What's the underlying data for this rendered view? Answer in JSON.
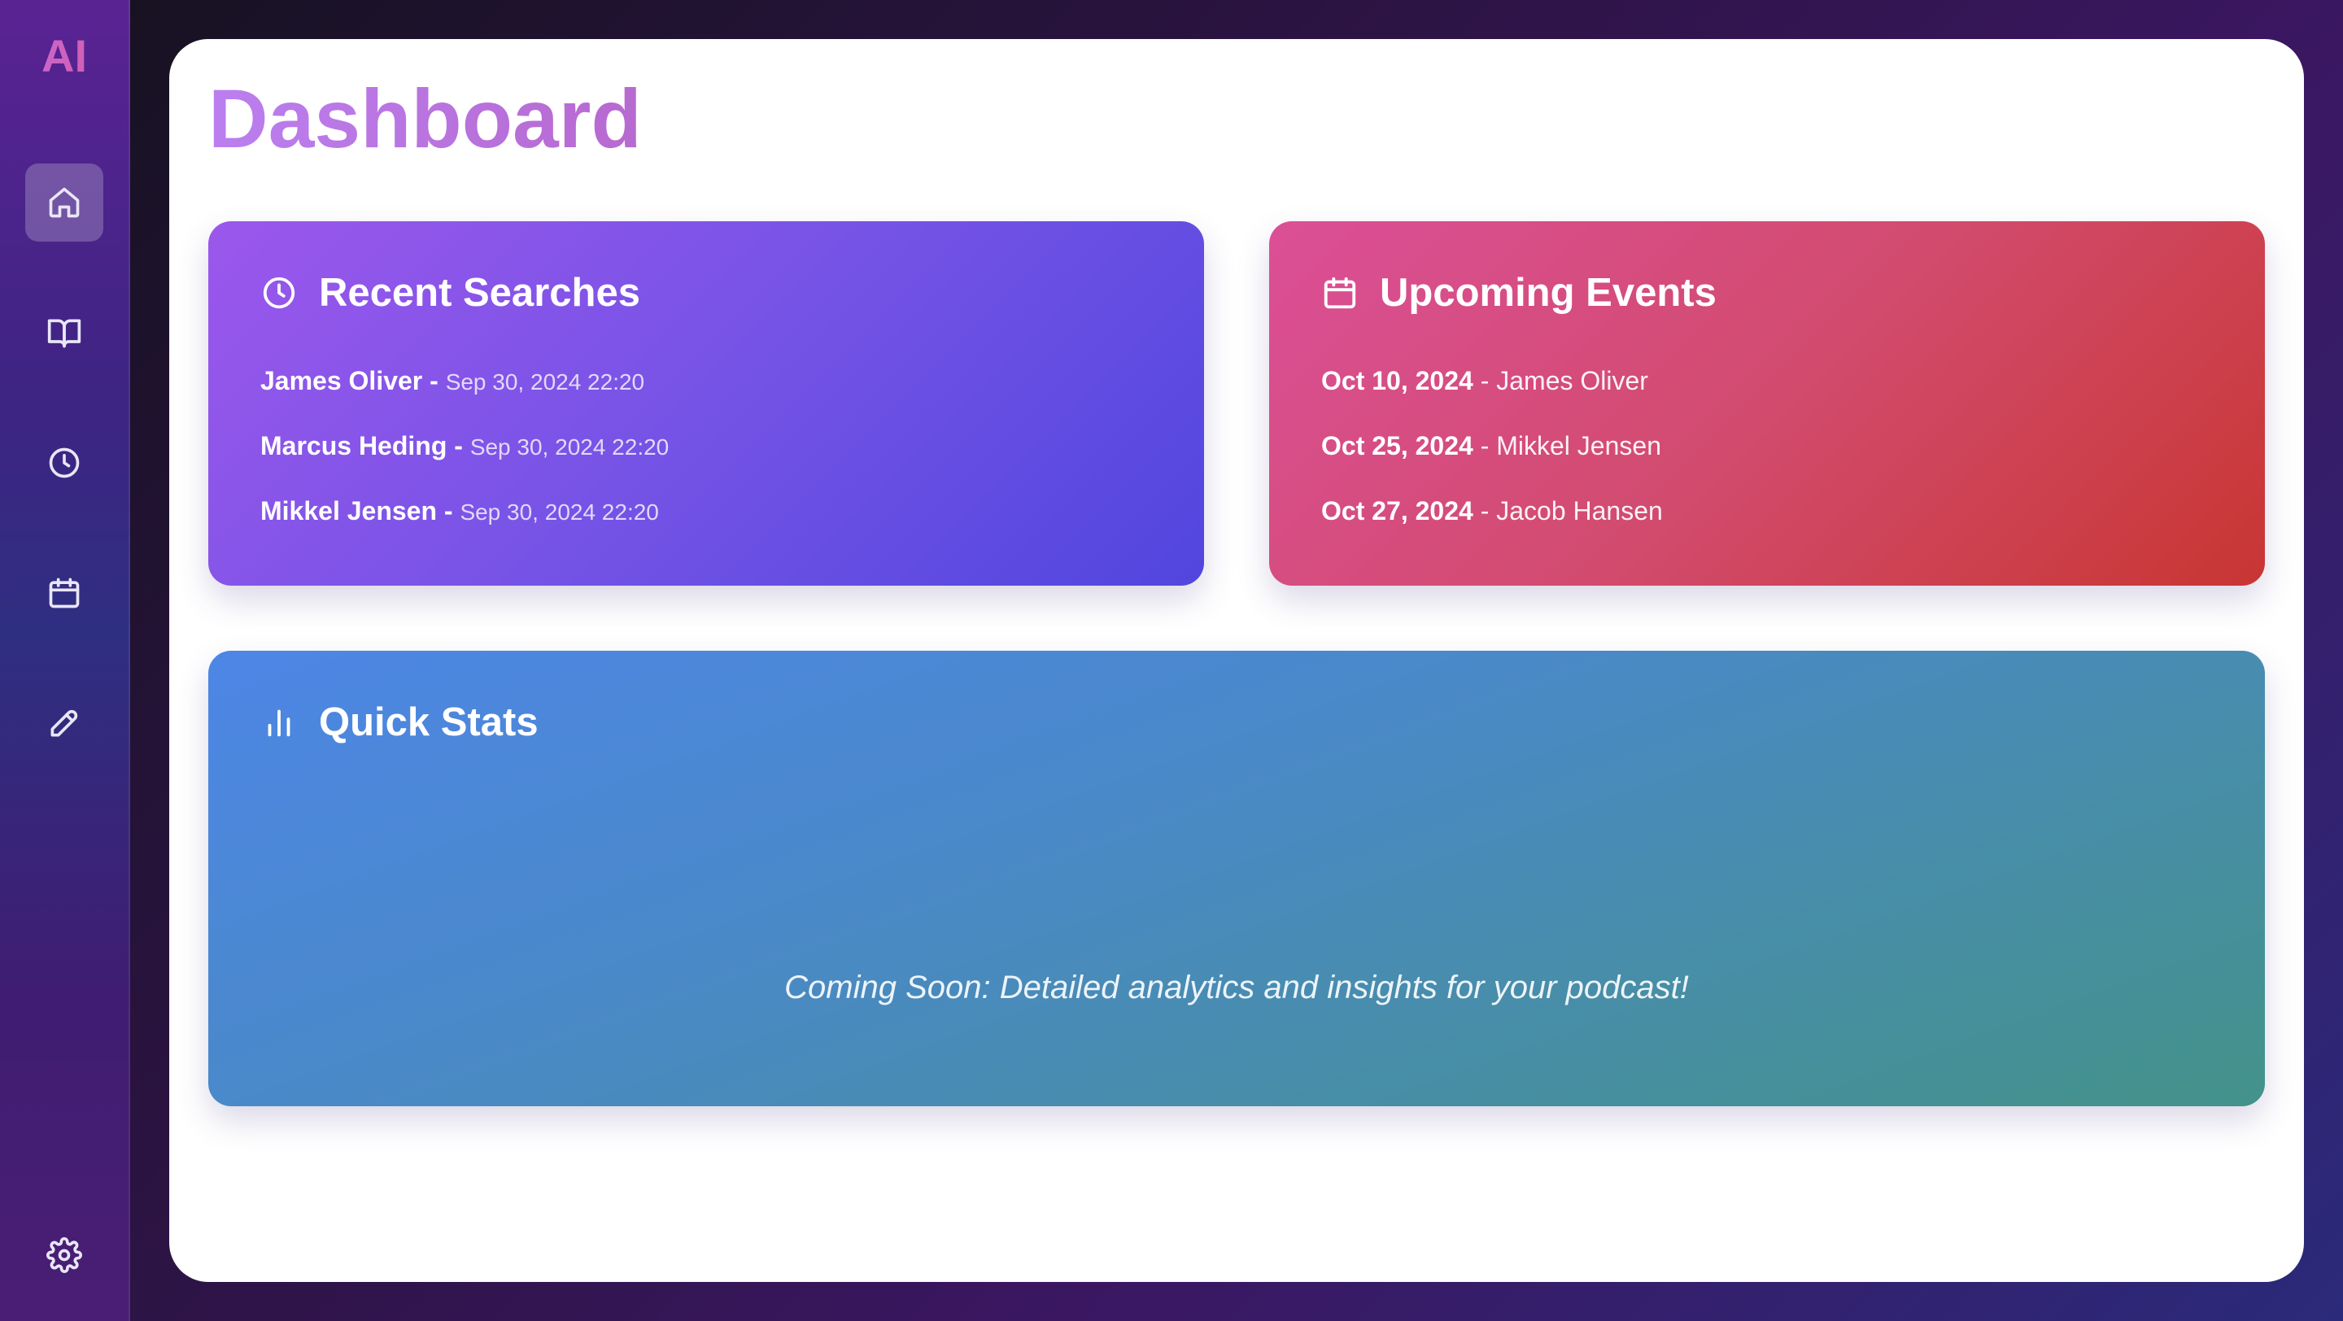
{
  "sidebar": {
    "logo": "AI",
    "items": [
      {
        "icon": "home-icon",
        "active": true
      },
      {
        "icon": "book-open-icon",
        "active": false
      },
      {
        "icon": "clock-icon",
        "active": false
      },
      {
        "icon": "calendar-icon",
        "active": false
      },
      {
        "icon": "pen-icon",
        "active": false
      }
    ],
    "footer_icon": "settings-gear-icon"
  },
  "page": {
    "title": "Dashboard"
  },
  "recent_searches": {
    "title": "Recent Searches",
    "icon": "clock-icon",
    "separator": " - ",
    "items": [
      {
        "name": "James Oliver",
        "time": "Sep 30, 2024 22:20"
      },
      {
        "name": "Marcus Heding",
        "time": "Sep 30, 2024 22:20"
      },
      {
        "name": "Mikkel Jensen",
        "time": "Sep 30, 2024 22:20"
      }
    ]
  },
  "upcoming_events": {
    "title": "Upcoming Events",
    "icon": "calendar-icon",
    "separator": " - ",
    "items": [
      {
        "date": "Oct 10, 2024",
        "name": "James Oliver"
      },
      {
        "date": "Oct 25, 2024",
        "name": "Mikkel Jensen"
      },
      {
        "date": "Oct 27, 2024",
        "name": "Jacob Hansen"
      }
    ]
  },
  "quick_stats": {
    "title": "Quick Stats",
    "icon": "bar-chart-icon",
    "message": "Coming Soon: Detailed analytics and insights for your podcast!"
  },
  "colors": {
    "recent_gradient": [
      "#9c57ec",
      "#5146de"
    ],
    "events_gradient": [
      "#db4f97",
      "#c83632"
    ],
    "stats_gradient": [
      "#4d86e6",
      "#43928a"
    ],
    "title_gradient": [
      "#bb7ff0",
      "#b769cf"
    ]
  }
}
